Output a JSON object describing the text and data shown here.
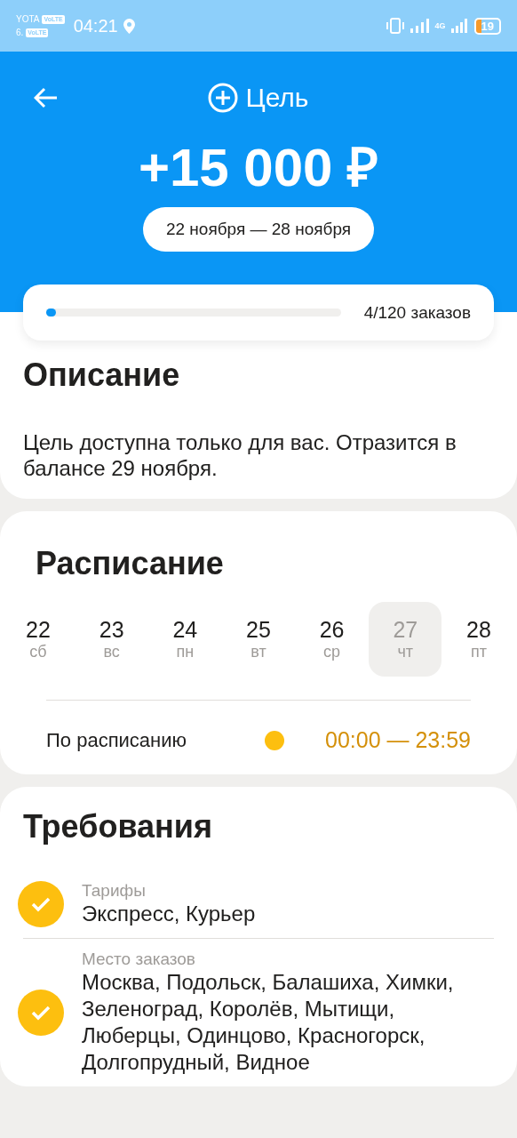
{
  "status_bar": {
    "carrier": "YOTA",
    "volte_1": "VoLTE",
    "sim2": "6.",
    "volte_2": "VoLTE",
    "time": "04:21",
    "network": "4G",
    "battery": "19"
  },
  "header": {
    "title": "Цель",
    "amount": "+15 000 ₽",
    "period": "22 ноября — 28 ноября"
  },
  "progress": {
    "level": 0.033,
    "reading": "4/120 заказов"
  },
  "description": {
    "title": "Описание",
    "text": "Цель доступна только для вас. Отразится в балансе 29 ноября."
  },
  "schedule": {
    "title": "Расписание",
    "days": [
      {
        "date": "22",
        "weekday": "сб",
        "selected": false
      },
      {
        "date": "23",
        "weekday": "вс",
        "selected": false
      },
      {
        "date": "24",
        "weekday": "пн",
        "selected": false
      },
      {
        "date": "25",
        "weekday": "вт",
        "selected": false
      },
      {
        "date": "26",
        "weekday": "ср",
        "selected": false
      },
      {
        "date": "27",
        "weekday": "чт",
        "selected": true
      },
      {
        "date": "28",
        "weekday": "пт",
        "selected": false
      }
    ],
    "slot": {
      "label": "По расписанию",
      "color": "#fdbf0f",
      "time": "00:00 — 23:59"
    }
  },
  "requirements": {
    "title": "Требования",
    "items": [
      {
        "label": "Тарифы",
        "value": "Экспресс, Курьер",
        "checked": true
      },
      {
        "label": "Место заказов",
        "value": "Москва, Подольск, Балашиха, Химки, Зеленоград, Королёв, Мытищи, Люберцы, Одинцово, Красногорск, Долгопрудный, Видное",
        "checked": true
      }
    ]
  }
}
